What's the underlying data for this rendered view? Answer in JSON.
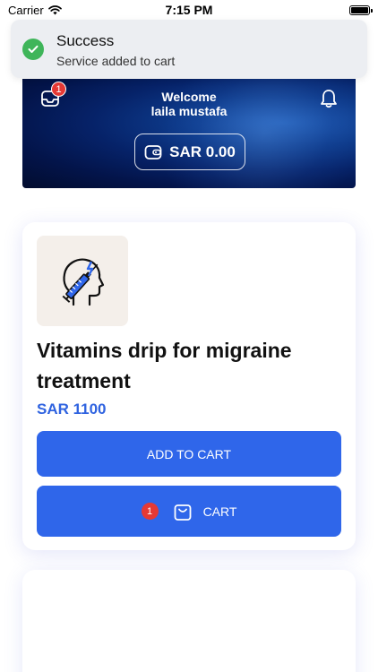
{
  "status_bar": {
    "carrier": "Carrier",
    "time": "7:15 PM"
  },
  "toast": {
    "title": "Success",
    "message": "Service added to cart",
    "icon": "check-icon",
    "color": "#3fb55a"
  },
  "header": {
    "welcome": "Welcome",
    "user_name": "laila mustafa",
    "inbox_badge": "1",
    "wallet_balance": "SAR 0.00",
    "icons": [
      "inbox-icon",
      "bell-icon",
      "wallet-icon"
    ]
  },
  "product": {
    "title": "Vitamins drip for migraine treatment",
    "price": "SAR 1100",
    "image_icon": "head-injection-icon",
    "add_to_cart_label": "ADD TO CART",
    "cart_label": "CART",
    "cart_count": "1"
  },
  "colors": {
    "accent": "#2f66ea",
    "price": "#2f63e0",
    "badge": "#e53935",
    "banner_dark": "#03144a"
  }
}
